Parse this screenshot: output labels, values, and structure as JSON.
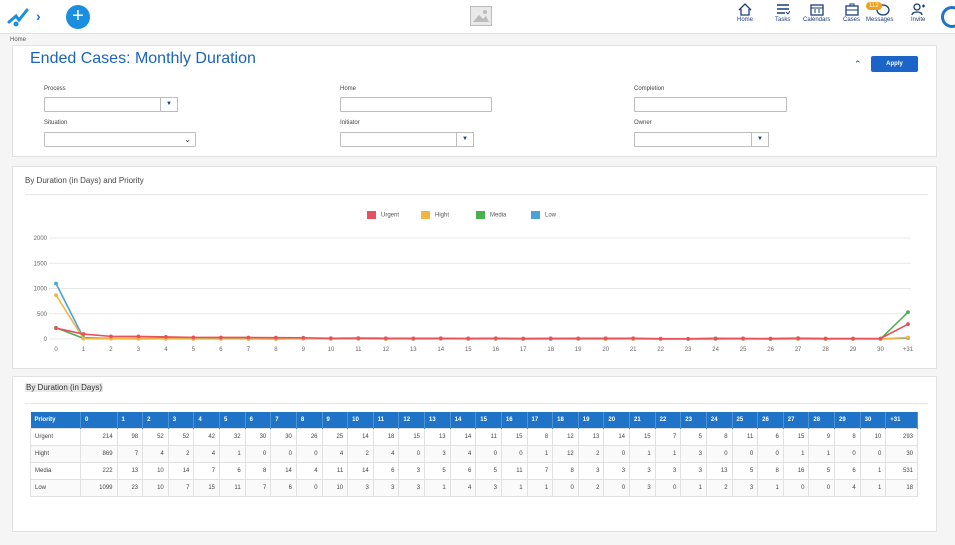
{
  "breadcrumb": "Home",
  "topnav": {
    "items": [
      {
        "label": "Home",
        "icon": "home-icon"
      },
      {
        "label": "Tasks",
        "icon": "tasks-icon"
      },
      {
        "label": "Calendars",
        "icon": "calendar-icon"
      },
      {
        "label": "Cases",
        "icon": "cases-icon"
      },
      {
        "label": "Messages",
        "icon": "messages-icon"
      },
      {
        "label": "Invite",
        "icon": "invite-icon"
      }
    ],
    "messages_badge": "112"
  },
  "filters": {
    "title": "Ended Cases: Monthly Duration",
    "apply_label": "Apply",
    "process_label": "Process",
    "home_label": "Home",
    "completion_label": "Completion",
    "situation_label": "Situation",
    "initiator_label": "Initiator",
    "owner_label": "Owner"
  },
  "chart_panel": {
    "title": "By Duration (in Days) and Priority"
  },
  "chart_data": {
    "type": "line",
    "title": "By Duration (in Days) and Priority",
    "categories": [
      "0",
      "1",
      "2",
      "3",
      "4",
      "5",
      "6",
      "7",
      "8",
      "9",
      "10",
      "11",
      "12",
      "13",
      "14",
      "15",
      "16",
      "17",
      "18",
      "19",
      "20",
      "21",
      "22",
      "23",
      "24",
      "25",
      "26",
      "27",
      "28",
      "29",
      "30",
      "+31"
    ],
    "y_ticks": [
      "0",
      "500",
      "1000",
      "1500",
      "2000"
    ],
    "ylim": [
      0,
      2000
    ],
    "grid": true,
    "legend_position": "top-center",
    "series": [
      {
        "name": "Urgent",
        "color": "#e8505b",
        "values": [
          214,
          98,
          52,
          52,
          42,
          32,
          30,
          30,
          26,
          25,
          14,
          18,
          15,
          13,
          14,
          11,
          15,
          8,
          12,
          13,
          14,
          15,
          7,
          5,
          8,
          11,
          6,
          15,
          9,
          8,
          10,
          293
        ]
      },
      {
        "name": "Hight",
        "color": "#f2b544",
        "values": [
          869,
          7,
          4,
          2,
          4,
          1,
          0,
          0,
          0,
          4,
          2,
          4,
          0,
          3,
          4,
          0,
          0,
          1,
          12,
          2,
          0,
          1,
          1,
          3,
          0,
          0,
          0,
          1,
          1,
          0,
          0,
          30
        ]
      },
      {
        "name": "Media",
        "color": "#4caf50",
        "values": [
          222,
          13,
          10,
          14,
          7,
          6,
          8,
          14,
          4,
          11,
          14,
          6,
          3,
          5,
          6,
          5,
          11,
          7,
          8,
          3,
          3,
          3,
          3,
          3,
          13,
          5,
          8,
          16,
          5,
          6,
          1,
          531
        ]
      },
      {
        "name": "Low",
        "color": "#4aa3d8",
        "values": [
          1099,
          23,
          10,
          7,
          15,
          11,
          7,
          6,
          0,
          10,
          3,
          3,
          3,
          1,
          4,
          3,
          1,
          1,
          0,
          2,
          0,
          3,
          0,
          1,
          2,
          3,
          1,
          0,
          0,
          4,
          1,
          18
        ]
      }
    ]
  },
  "table_panel": {
    "title": "By Duration (in Days)",
    "header_first": "Priority"
  }
}
